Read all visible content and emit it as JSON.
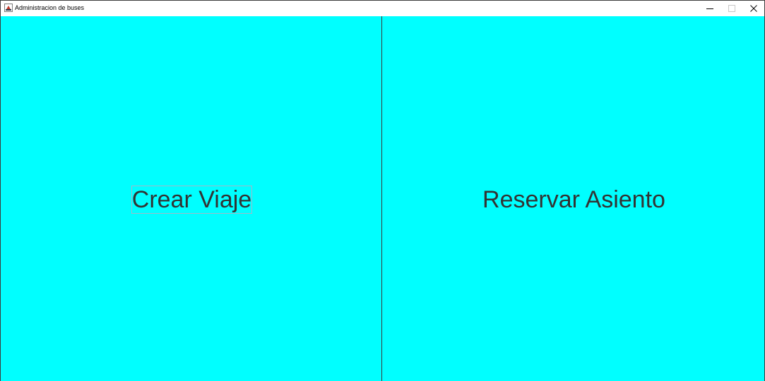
{
  "window": {
    "title": "Administracion de buses",
    "icon": "java-cup-icon",
    "controls": {
      "minimize": "minimize-icon",
      "maximize": "maximize-icon",
      "close": "close-icon"
    }
  },
  "buttons": {
    "crear_viaje": "Crear Viaje",
    "reservar_asiento": "Reservar Asiento"
  },
  "colors": {
    "panel_background": "#00ffff",
    "button_text": "#333333",
    "titlebar": "#ffffff"
  }
}
